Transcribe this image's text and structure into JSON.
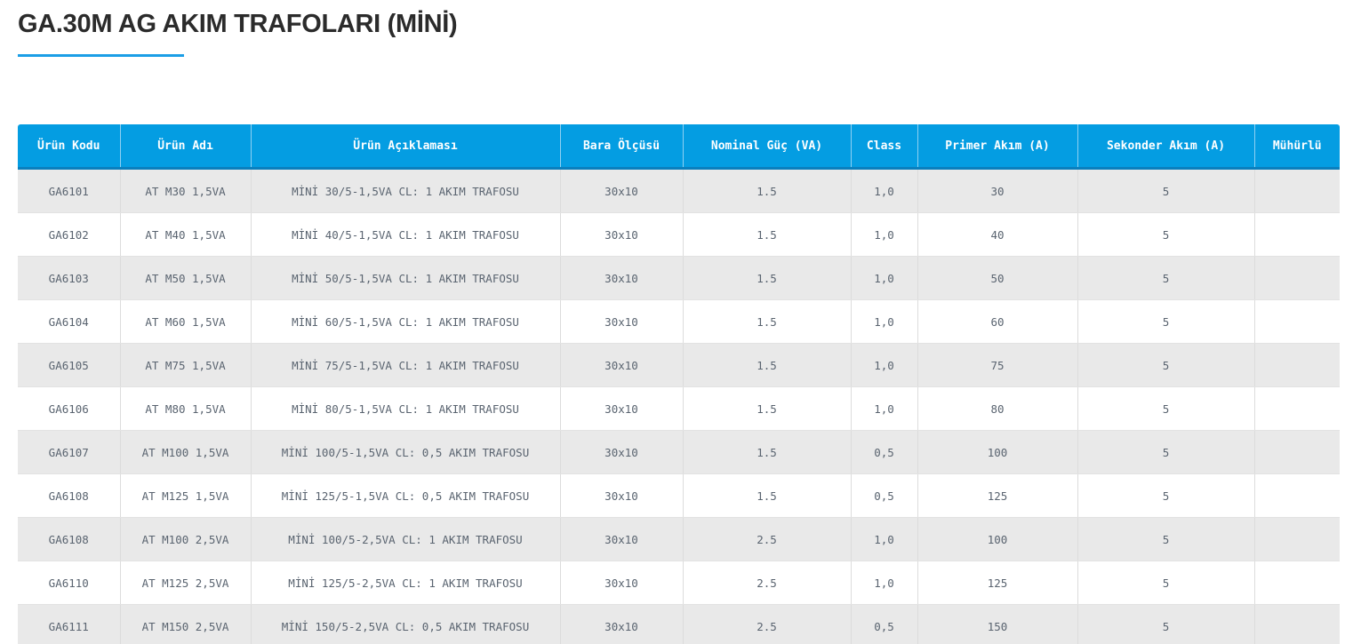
{
  "page": {
    "title": "GA.30M AG AKIM TRAFOLARI (MİNİ)"
  },
  "colors": {
    "header_bg": "#049de2",
    "accent_underline": "#1b9ee6",
    "row_alt": "#e9e9e9"
  },
  "table": {
    "columns": [
      "Ürün Kodu",
      "Ürün Adı",
      "Ürün Açıklaması",
      "Bara Ölçüsü",
      "Nominal Güç (VA)",
      "Class",
      "Primer Akım (A)",
      "Sekonder Akım (A)",
      "Mühürlü"
    ],
    "rows": [
      [
        "GA6101",
        "AT M30 1,5VA",
        "MİNİ 30/5-1,5VA CL: 1 AKIM TRAFOSU",
        "30x10",
        "1.5",
        "1,0",
        "30",
        "5",
        ""
      ],
      [
        "GA6102",
        "AT M40 1,5VA",
        "MİNİ 40/5-1,5VA CL: 1 AKIM TRAFOSU",
        "30x10",
        "1.5",
        "1,0",
        "40",
        "5",
        ""
      ],
      [
        "GA6103",
        "AT M50 1,5VA",
        "MİNİ 50/5-1,5VA CL: 1 AKIM TRAFOSU",
        "30x10",
        "1.5",
        "1,0",
        "50",
        "5",
        ""
      ],
      [
        "GA6104",
        "AT M60 1,5VA",
        "MİNİ 60/5-1,5VA CL: 1 AKIM TRAFOSU",
        "30x10",
        "1.5",
        "1,0",
        "60",
        "5",
        ""
      ],
      [
        "GA6105",
        "AT M75 1,5VA",
        "MİNİ 75/5-1,5VA CL: 1 AKIM TRAFOSU",
        "30x10",
        "1.5",
        "1,0",
        "75",
        "5",
        ""
      ],
      [
        "GA6106",
        "AT M80 1,5VA",
        "MİNİ 80/5-1,5VA CL: 1 AKIM TRAFOSU",
        "30x10",
        "1.5",
        "1,0",
        "80",
        "5",
        ""
      ],
      [
        "GA6107",
        "AT M100 1,5VA",
        "MİNİ 100/5-1,5VA CL: 0,5 AKIM TRAFOSU",
        "30x10",
        "1.5",
        "0,5",
        "100",
        "5",
        ""
      ],
      [
        "GA6108",
        "AT M125 1,5VA",
        "MİNİ 125/5-1,5VA CL: 0,5 AKIM TRAFOSU",
        "30x10",
        "1.5",
        "0,5",
        "125",
        "5",
        ""
      ],
      [
        "GA6108",
        "AT M100 2,5VA",
        "MİNİ 100/5-2,5VA CL: 1 AKIM TRAFOSU",
        "30x10",
        "2.5",
        "1,0",
        "100",
        "5",
        ""
      ],
      [
        "GA6110",
        "AT M125 2,5VA",
        "MİNİ 125/5-2,5VA CL: 1 AKIM TRAFOSU",
        "30x10",
        "2.5",
        "1,0",
        "125",
        "5",
        ""
      ],
      [
        "GA6111",
        "AT M150 2,5VA",
        "MİNİ 150/5-2,5VA CL: 0,5 AKIM TRAFOSU",
        "30x10",
        "2.5",
        "0,5",
        "150",
        "5",
        ""
      ]
    ]
  }
}
